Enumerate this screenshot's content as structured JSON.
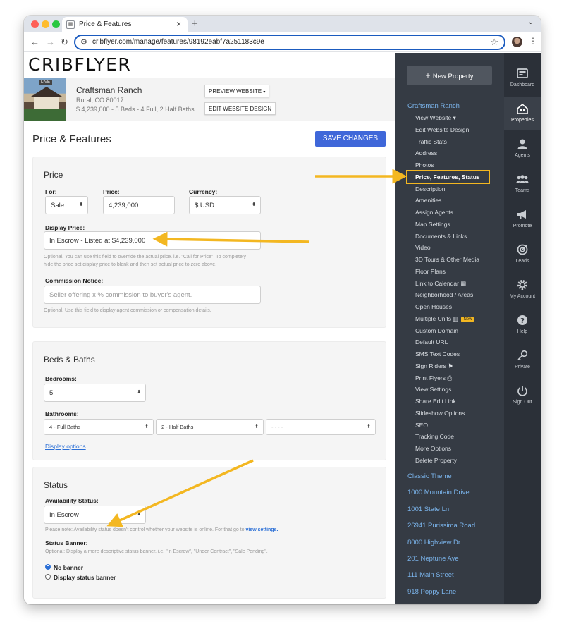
{
  "browser": {
    "tab_title": "Price & Features",
    "url": "cribflyer.com/manage/features/98192eabf7a251183c9e"
  },
  "brand": {
    "logo": "CRIBFLYER"
  },
  "property": {
    "badge": "LIVE",
    "name": "Craftsman Ranch",
    "location": "Rural, CO 80017",
    "summary": "$ 4,239,000 - 5 Beds - 4 Full, 2 Half Baths",
    "preview_button": "PREVIEW WEBSITE",
    "edit_design_button": "EDIT WEBSITE DESIGN"
  },
  "page": {
    "title": "Price & Features",
    "save_button": "SAVE CHANGES"
  },
  "price_section": {
    "title": "Price",
    "for_label": "For:",
    "for_value": "Sale",
    "price_label": "Price:",
    "price_value": "4,239,000",
    "currency_label": "Currency:",
    "currency_value": "$ USD",
    "display_price_label": "Display Price:",
    "display_price_value": "In Escrow - Listed at $4,239,000",
    "display_price_help_1": "Optional. You can use this field to override the actual price. i.e. \"Call for Price\". To completely",
    "display_price_help_2": "hide the price set display price to blank and then set actual price to zero above.",
    "commission_label": "Commission Notice:",
    "commission_placeholder": "Seller offering x % commission to buyer's agent.",
    "commission_help": "Optional. Use this field to display agent commission or compensation details."
  },
  "beds_section": {
    "title": "Beds & Baths",
    "bedrooms_label": "Bedrooms:",
    "bedrooms_value": "5",
    "bathrooms_label": "Bathrooms:",
    "full_baths": "4 - Full Baths",
    "half_baths": "2 - Half Baths",
    "other_baths": "- - - -",
    "display_options_link": "Display options"
  },
  "status_section": {
    "title": "Status",
    "availability_label": "Availability Status:",
    "availability_value": "In Escrow",
    "note_text": "Please note: Availability status doesn't control whether your website is online. For that go to",
    "note_link": "view settings.",
    "banner_label": "Status Banner:",
    "banner_help": "Optional: Display a more descriptive status banner. i.e. \"In Escrow\", \"Under Contract\", \"Sale Pending\".",
    "option_no_banner": "No banner",
    "option_display_banner": "Display status banner",
    "selected_option": "No banner"
  },
  "sidebar": {
    "new_property": "New Property",
    "current_property": "Craftsman Ranch",
    "menu": [
      "View Website",
      "Edit Website Design",
      "Traffic Stats",
      "Address",
      "Photos",
      "Price, Features, Status",
      "Description",
      "Amenities",
      "Assign Agents",
      "Map Settings",
      "Documents & Links",
      "Video",
      "3D Tours & Other Media",
      "Floor Plans",
      "Link to Calendar",
      "Neighborhood / Areas",
      "Open Houses",
      "Multiple Units",
      "Custom Domain",
      "Default URL",
      "SMS Text Codes",
      "Sign Riders",
      "Print Flyers",
      "View Settings",
      "Share Edit Link",
      "Slideshow Options",
      "SEO",
      "Tracking Code",
      "More Options",
      "Delete Property"
    ],
    "active_item": "Price, Features, Status",
    "new_badge": "New",
    "other_properties": [
      "Classic Theme",
      "1000 Mountain Drive",
      "1001 State Ln",
      "26941 Purissima Road",
      "8000 Highview Dr",
      "201 Neptune Ave",
      "111 Main Street",
      "918 Poppy Lane"
    ]
  },
  "rail": [
    {
      "label": "Dashboard",
      "icon": "dashboard-icon"
    },
    {
      "label": "Properties",
      "icon": "properties-icon",
      "active": true
    },
    {
      "label": "Agents",
      "icon": "agents-icon"
    },
    {
      "label": "Teams",
      "icon": "teams-icon"
    },
    {
      "label": "Promote",
      "icon": "megaphone-icon"
    },
    {
      "label": "Leads",
      "icon": "leads-icon"
    },
    {
      "label": "My Account",
      "icon": "gear-icon"
    },
    {
      "label": "Help",
      "icon": "help-icon"
    },
    {
      "label": "Private",
      "icon": "key-icon"
    },
    {
      "label": "Sign Out",
      "icon": "power-icon"
    }
  ],
  "colors": {
    "accent_blue": "#3f67d9",
    "sidebar_bg": "#353b44",
    "rail_bg": "#2b3038",
    "highlight_yellow": "#f3b721",
    "link_blue": "#7ab3ea"
  }
}
